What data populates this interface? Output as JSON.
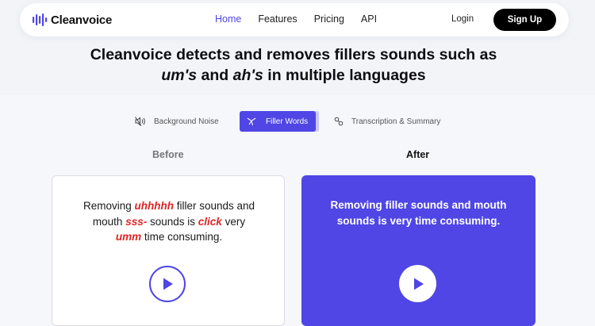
{
  "nav": {
    "logo_text": "Cleanvoice",
    "links": [
      "Home",
      "Features",
      "Pricing",
      "API"
    ],
    "active_link": "Home",
    "login": "Login",
    "signup": "Sign Up"
  },
  "headline": {
    "line1": "Cleanvoice detects and removes fillers sounds such as",
    "line2_em1": "um's",
    "line2_mid": " and ",
    "line2_em2": "ah's",
    "line2_end": " in multiple languages"
  },
  "tabs": {
    "background_noise": "Background Noise",
    "filler_words": "Filler Words",
    "transcription": "Transcription & Summary",
    "active": "Filler Words"
  },
  "compare": {
    "before_label": "Before",
    "after_label": "After",
    "before_text": {
      "t1": "Removing ",
      "f1": "uhhhhh",
      "t2": " filler sounds and mouth ",
      "f2": "sss-",
      "t3": " sounds is ",
      "f3": "click",
      "t4": " very ",
      "f4": "umm",
      "t5": " time consuming."
    },
    "after_text": "Removing filler sounds and mouth sounds is very time consuming."
  },
  "colors": {
    "accent": "#4f46e5",
    "filler_red": "#e02424",
    "signup_bg": "#000000"
  },
  "icons": {
    "logo": "waveform-icon",
    "background_noise": "mute-icon",
    "filler_words": "scissors-icon",
    "transcription": "transcription-icon",
    "play": "play-icon"
  }
}
